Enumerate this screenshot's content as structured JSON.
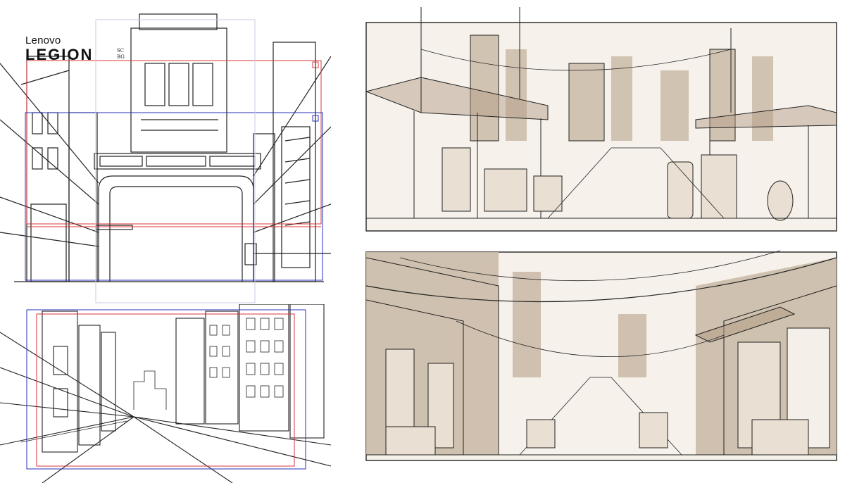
{
  "logo": {
    "brand": "Lenovo",
    "line": "LEGION"
  },
  "sketch_a": {
    "code_top": "SC",
    "code_bottom": "BG"
  },
  "colors": {
    "guide_red": "#d8343a",
    "guide_blue": "#2732b8",
    "ink": "#222222",
    "sepia_wash": "#cbbba9",
    "sepia_dark": "#b09a82"
  }
}
